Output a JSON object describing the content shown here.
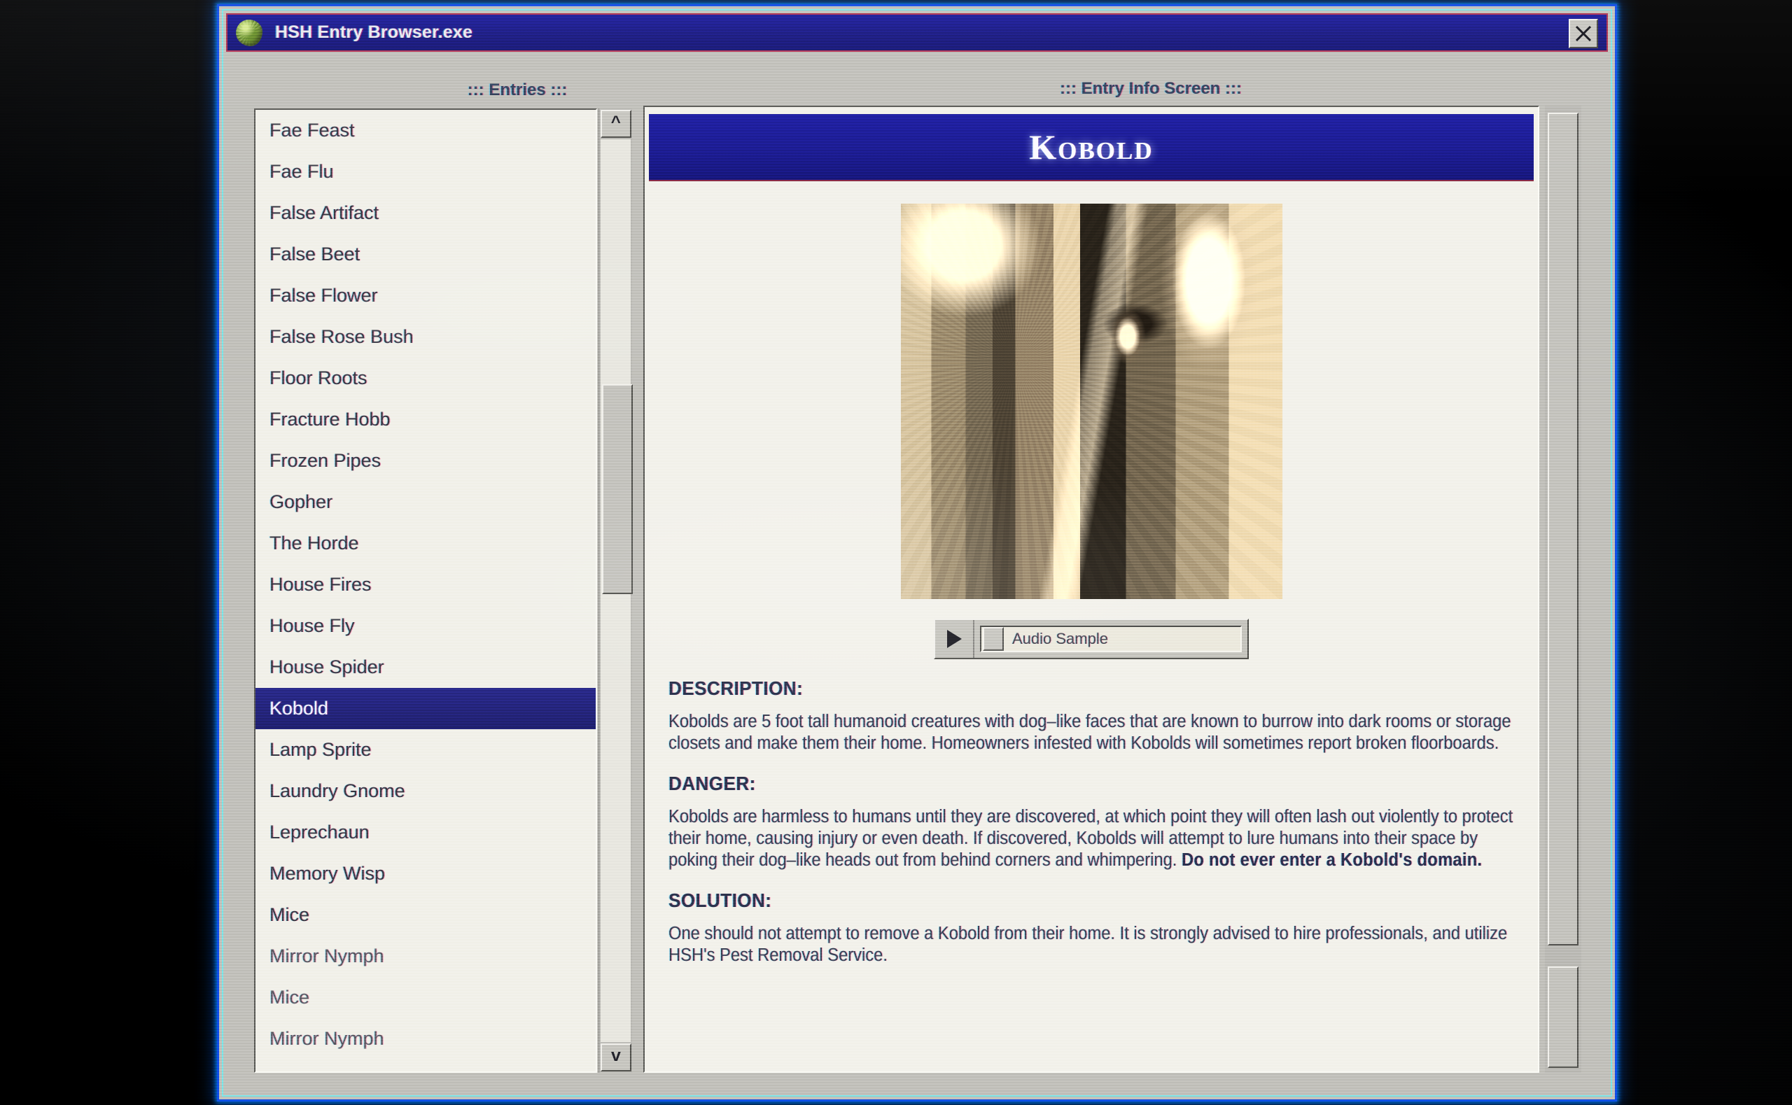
{
  "window": {
    "title": "HSH Entry Browser.exe",
    "icon": "green-orb-icon",
    "close_label": "close-icon",
    "accent_blue": "#1050e8",
    "titlebar_blue": "#1b1b9e",
    "chrome_gray": "#c3c2bd"
  },
  "headings": {
    "entries": "::: Entries :::",
    "info": "::: Entry Info Screen :::"
  },
  "entries_list": {
    "selected": "Kobold",
    "selection_color": "#2a2a8e",
    "items": [
      "Fae Feast",
      "Fae Flu",
      "False Artifact",
      "False Beet",
      "False Flower",
      "False Rose Bush",
      "Floor Roots",
      "Fracture Hobb",
      "Frozen Pipes",
      "Gopher",
      "The Horde",
      "House Fires",
      "House Fly",
      "House Spider",
      "Kobold",
      "Lamp Sprite",
      "Laundry Gnome",
      "Leprechaun",
      "Memory Wisp",
      "Mice",
      "Mirror Nymph",
      "Mice",
      "Mirror Nymph"
    ]
  },
  "scrollbars": {
    "up_arrow": "^",
    "down_arrow": "v"
  },
  "entry": {
    "title": "Kobold",
    "image_alt": "dark-doorway-with-creature-photo",
    "audio": {
      "play_label": "play-icon",
      "label": "Audio Sample"
    },
    "sections": [
      {
        "heading": "DESCRIPTION:",
        "body": "Kobolds are 5 foot tall humanoid creatures with dog–like faces that are known to burrow into dark rooms or storage closets and make them their home. Homeowners infested with Kobolds will sometimes report broken floorboards.",
        "bold_tail": ""
      },
      {
        "heading": "DANGER:",
        "body": "Kobolds are harmless to humans until they are discovered, at which point they will often lash out violently to protect their home, causing injury or even death. If discovered, Kobolds will attempt to lure humans into their space by poking their dog–like heads out from behind corners and whimpering. ",
        "bold_tail": "Do not ever enter a Kobold's domain."
      },
      {
        "heading": "SOLUTION:",
        "body": "One should not attempt to remove a Kobold from their home. It is strongly advised to hire professionals, and utilize HSH's Pest Removal Service.",
        "bold_tail": ""
      }
    ]
  }
}
